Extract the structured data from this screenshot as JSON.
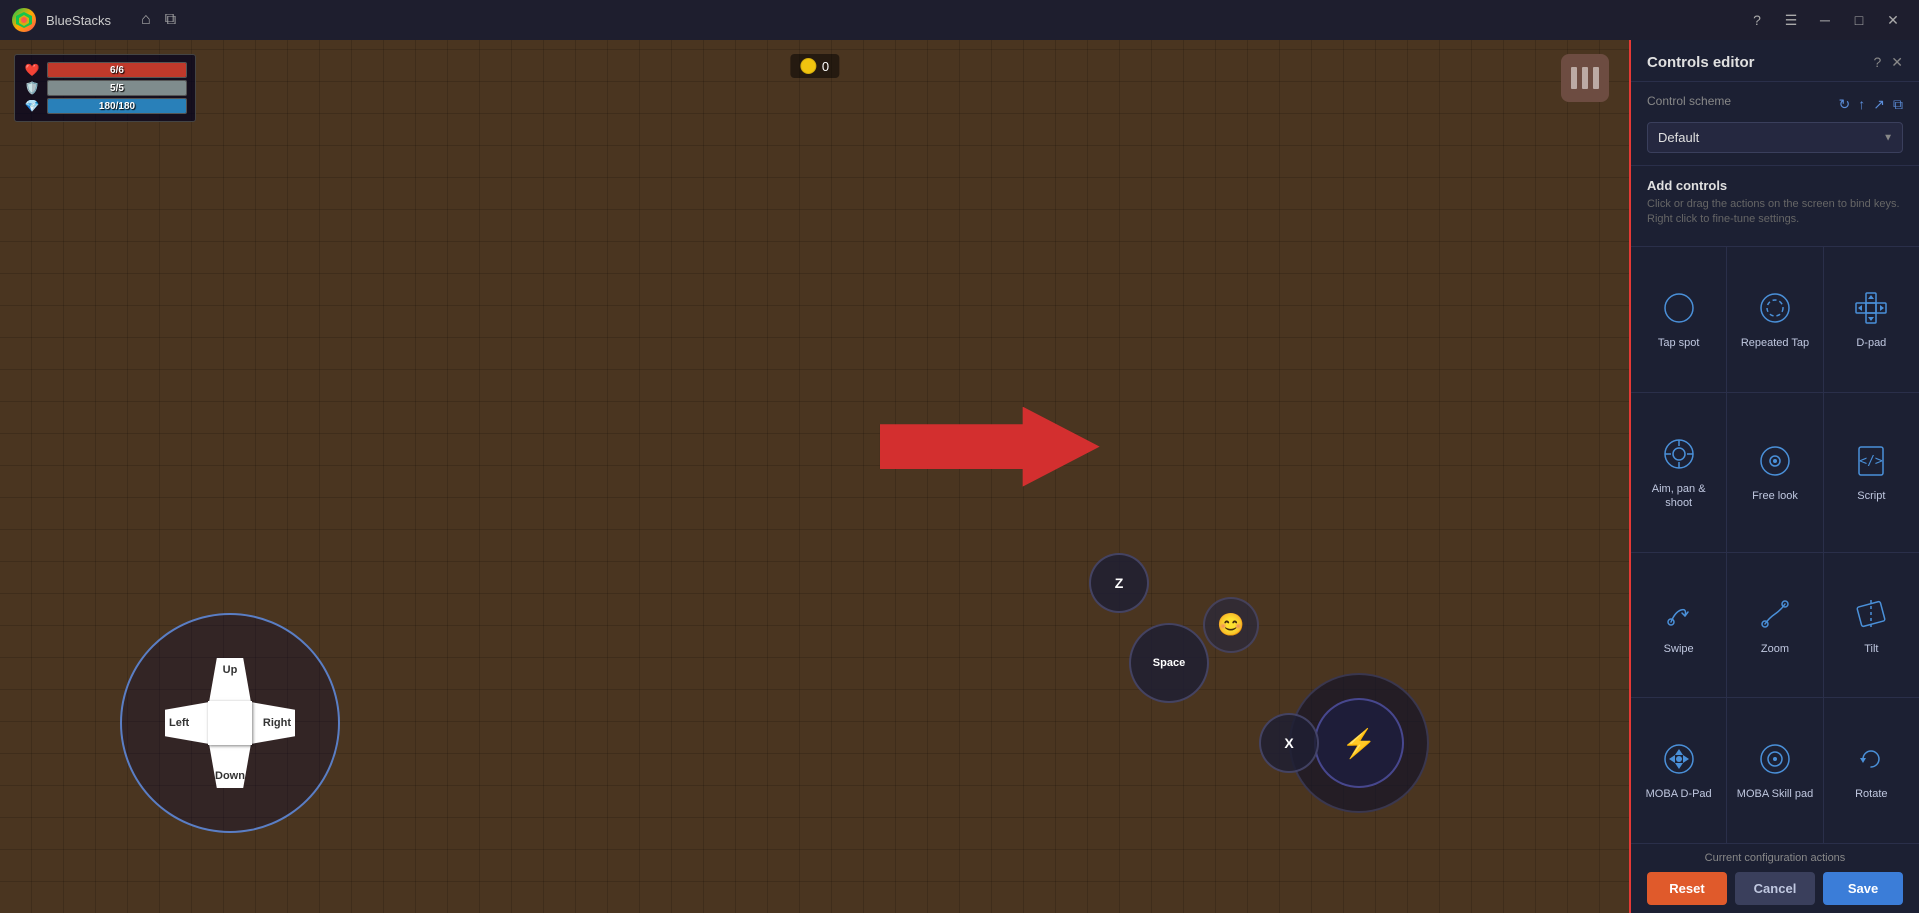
{
  "titleBar": {
    "appName": "BlueStacks",
    "homeIcon": "home-icon",
    "windowIcon": "window-icon",
    "helpIcon": "help-icon",
    "menuIcon": "menu-icon",
    "minimizeIcon": "minimize-icon",
    "maximizeIcon": "maximize-icon",
    "closeIcon": "close-icon"
  },
  "hud": {
    "hp": "6/6",
    "mp": "5/5",
    "sp": "180/180",
    "gold": "0"
  },
  "dpad": {
    "up": "Up",
    "down": "Down",
    "left": "Left",
    "right": "Right"
  },
  "actionButtons": {
    "space": "Space",
    "z": "Z",
    "x": "X"
  },
  "panel": {
    "title": "Controls editor",
    "controlSchemeLabel": "Control scheme",
    "selectedScheme": "Default",
    "addControlsTitle": "Add controls",
    "addControlsDesc": "Click or drag the actions on the screen to bind keys. Right click to fine-tune settings.",
    "controls": [
      {
        "id": "tap-spot",
        "label": "Tap spot",
        "icon": "tap-spot-icon"
      },
      {
        "id": "repeated-tap",
        "label": "Repeated Tap",
        "icon": "repeated-tap-icon"
      },
      {
        "id": "d-pad",
        "label": "D-pad",
        "icon": "d-pad-icon"
      },
      {
        "id": "aim-pan-shoot",
        "label": "Aim, pan & shoot",
        "icon": "aim-pan-shoot-icon"
      },
      {
        "id": "free-look",
        "label": "Free look",
        "icon": "free-look-icon"
      },
      {
        "id": "script",
        "label": "Script",
        "icon": "script-icon"
      },
      {
        "id": "swipe",
        "label": "Swipe",
        "icon": "swipe-icon"
      },
      {
        "id": "zoom",
        "label": "Zoom",
        "icon": "zoom-icon"
      },
      {
        "id": "tilt",
        "label": "Tilt",
        "icon": "tilt-icon"
      },
      {
        "id": "moba-d-pad",
        "label": "MOBA D-Pad",
        "icon": "moba-d-pad-icon"
      },
      {
        "id": "moba-skill-pad",
        "label": "MOBA Skill pad",
        "icon": "moba-skill-pad-icon"
      },
      {
        "id": "rotate",
        "label": "Rotate",
        "icon": "rotate-icon"
      }
    ],
    "currentConfigLabel": "Current configuration actions",
    "resetLabel": "Reset",
    "cancelLabel": "Cancel",
    "saveLabel": "Save"
  }
}
